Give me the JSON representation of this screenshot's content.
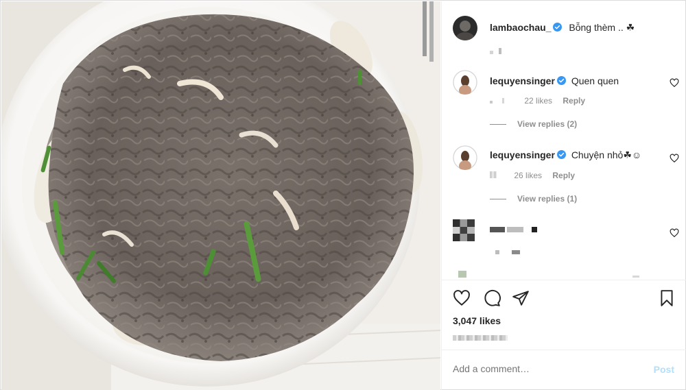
{
  "post": {
    "author": "lambaochau_",
    "caption": "Bỗng thèm .. ☘",
    "likes": "3,047 likes"
  },
  "comments": [
    {
      "user": "lequyensinger",
      "text": "Quen quen",
      "likes": "22 likes",
      "reply": "Reply",
      "view_replies": "View replies (2)"
    },
    {
      "user": "lequyensinger",
      "text": "Chuyện nhỏ☘☺",
      "likes": "26 likes",
      "reply": "Reply",
      "view_replies": "View replies (1)"
    }
  ],
  "comment_box": {
    "placeholder": "Add a comment…",
    "post_label": "Post"
  },
  "icons": {
    "like": "heart-icon",
    "comment": "comment-icon",
    "share": "paper-plane-icon",
    "save": "bookmark-icon",
    "verified": "verified-badge-icon"
  },
  "colors": {
    "verified_blue": "#3897f0",
    "post_disabled": "#b2dffc",
    "secondary_text": "#8e8e8e"
  }
}
